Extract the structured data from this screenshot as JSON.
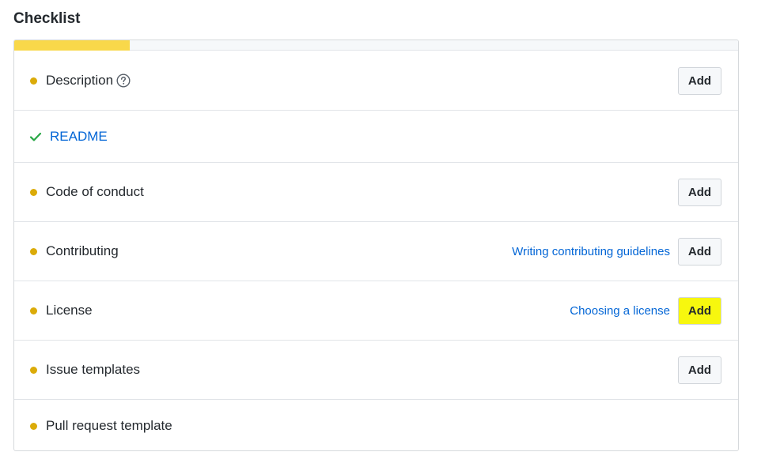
{
  "page": {
    "title": "Checklist"
  },
  "progress": {
    "fraction": 0.16,
    "color": "#f9d84a"
  },
  "colors": {
    "pending_dot": "#dbab09",
    "done_check": "#28a745",
    "link": "#0366d6",
    "highlight": "#f7f70e"
  },
  "items": [
    {
      "label": "Description",
      "status": "pending",
      "icon": "question-circle-icon",
      "add_label": "Add"
    },
    {
      "label": "README",
      "status": "done",
      "icon": "check-icon"
    },
    {
      "label": "Code of conduct",
      "status": "pending",
      "add_label": "Add"
    },
    {
      "label": "Contributing",
      "status": "pending",
      "hint": "Writing contributing guidelines",
      "add_label": "Add"
    },
    {
      "label": "License",
      "status": "pending",
      "hint": "Choosing a license",
      "add_label": "Add",
      "highlighted": true
    },
    {
      "label": "Issue templates",
      "status": "pending",
      "add_label": "Add"
    },
    {
      "label": "Pull request template",
      "status": "pending"
    }
  ]
}
